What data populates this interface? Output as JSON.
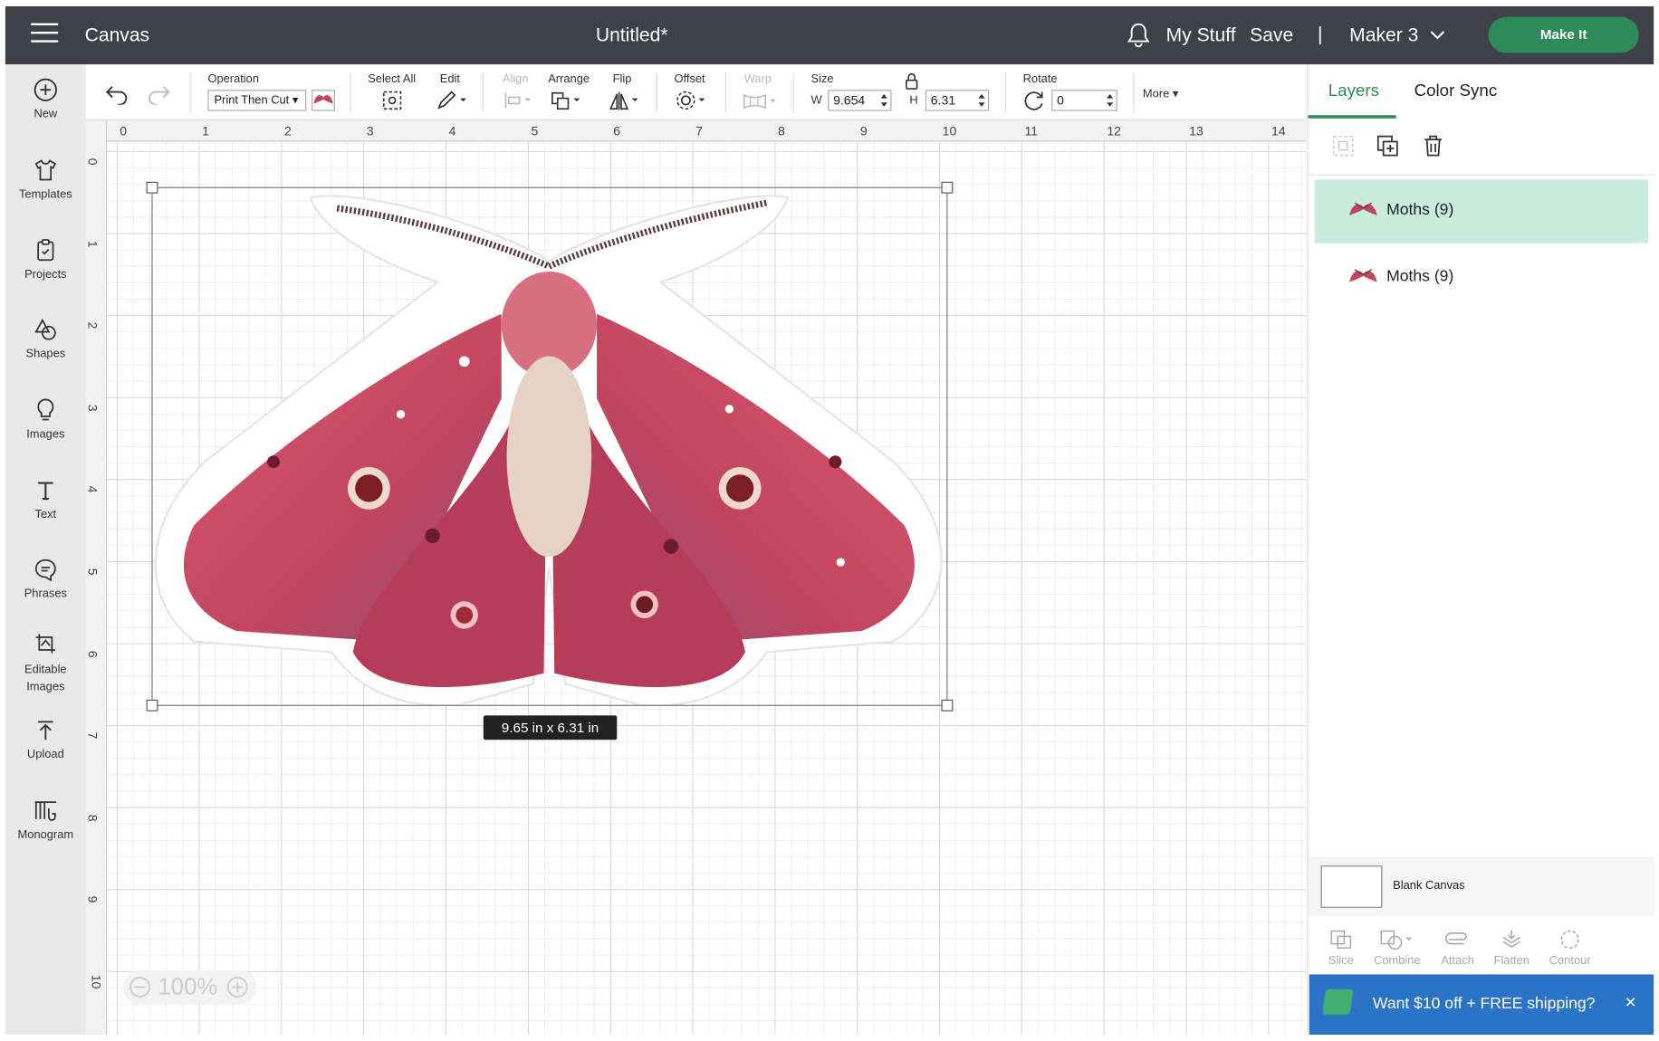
{
  "topbar": {
    "app_title": "Canvas",
    "doc_title": "Untitled*",
    "my_stuff": "My Stuff",
    "save": "Save",
    "separator": "|",
    "machine": "Maker 3",
    "make_it": "Make It"
  },
  "sidebar": {
    "items": [
      {
        "label": "New",
        "icon": "plus-circle-icon"
      },
      {
        "label": "Templates",
        "icon": "shirt-icon"
      },
      {
        "label": "Projects",
        "icon": "clipboard-icon"
      },
      {
        "label": "Shapes",
        "icon": "shapes-icon"
      },
      {
        "label": "Images",
        "icon": "bulb-icon"
      },
      {
        "label": "Text",
        "icon": "text-icon"
      },
      {
        "label": "Phrases",
        "icon": "speech-icon"
      },
      {
        "label": "Editable Images",
        "icon": "editable-image-icon"
      },
      {
        "label": "Upload",
        "icon": "upload-icon"
      },
      {
        "label": "Monogram",
        "icon": "monogram-icon"
      }
    ]
  },
  "toolbar": {
    "operation_label": "Operation",
    "operation_value": "Print Then Cut",
    "select_all": "Select All",
    "edit": "Edit",
    "align": "Align",
    "arrange": "Arrange",
    "flip": "Flip",
    "offset": "Offset",
    "warp": "Warp",
    "size": "Size",
    "w_label": "W",
    "w_value": "9.654",
    "h_label": "H",
    "h_value": "6.31",
    "rotate": "Rotate",
    "rotate_value": "0",
    "more": "More"
  },
  "canvas": {
    "ruler_top": [
      "0",
      "1",
      "2",
      "3",
      "4",
      "5",
      "6",
      "7",
      "8",
      "9",
      "10",
      "11",
      "12",
      "13",
      "14"
    ],
    "ruler_left": [
      "0",
      "1",
      "2",
      "3",
      "4",
      "5",
      "6",
      "7",
      "8",
      "9",
      "10"
    ],
    "size_tooltip": "9.65  in x 6.31  in",
    "zoom": "100%"
  },
  "panel": {
    "tabs": [
      "Layers",
      "Color Sync"
    ],
    "layers": [
      {
        "name": "Moths (9)",
        "selected": true
      },
      {
        "name": "Moths (9)",
        "selected": false
      }
    ],
    "blank_canvas": "Blank Canvas",
    "bottom_tools": [
      "Slice",
      "Combine",
      "Attach",
      "Flatten",
      "Contour"
    ]
  },
  "promo": {
    "text": "Want $10 off + FREE shipping?",
    "close": "×"
  },
  "colors": {
    "topbar": "#3e4247",
    "accent_green": "#2f8a5a",
    "selected_layer": "#c9ecdf",
    "promo_blue": "#2a73c7",
    "moth_pink": "#c2455f"
  }
}
